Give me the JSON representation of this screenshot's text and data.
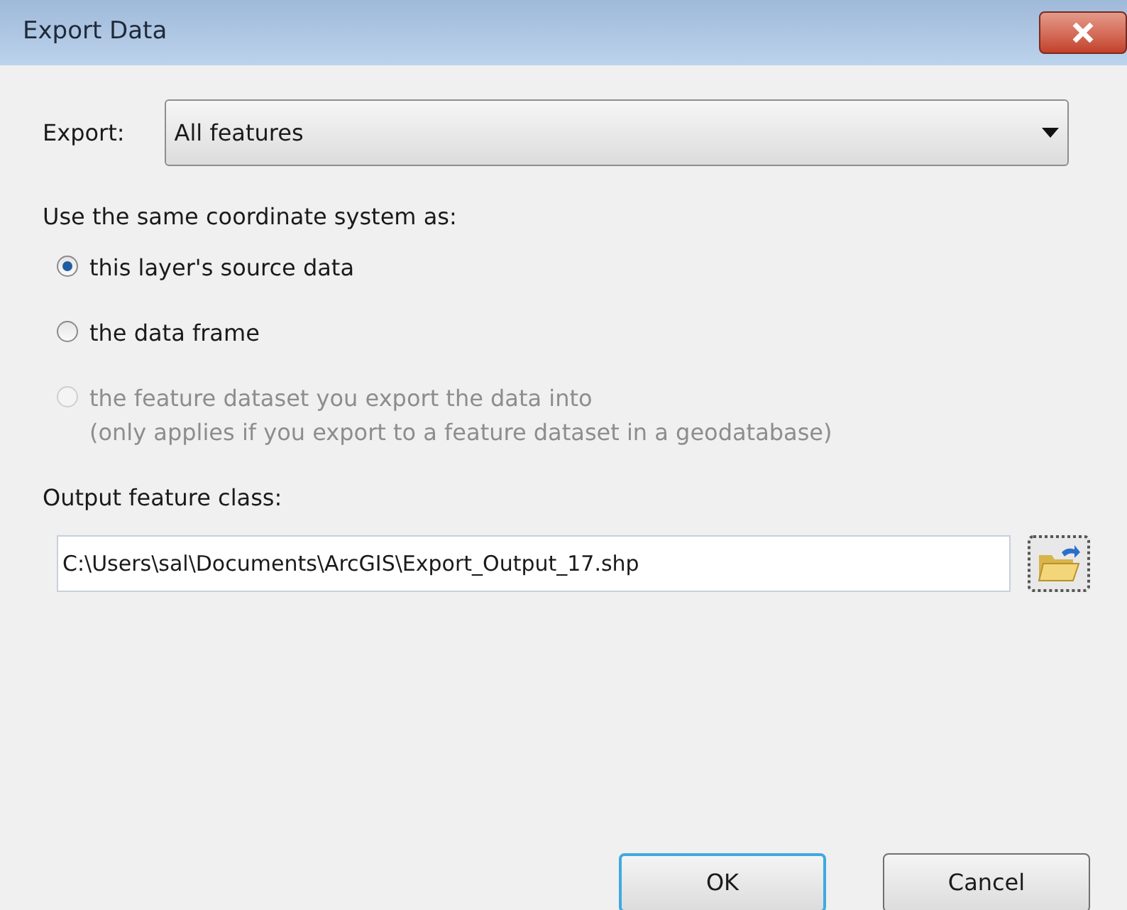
{
  "window": {
    "title": "Export Data"
  },
  "export": {
    "label": "Export:",
    "value": "All features"
  },
  "coordinate_system": {
    "label": "Use the same coordinate system as:",
    "options": [
      {
        "label": "this layer's source data",
        "selected": true,
        "disabled": false
      },
      {
        "label": "the data frame",
        "selected": false,
        "disabled": false
      },
      {
        "label": "the feature dataset you export the data into",
        "note": "(only applies if you export to a feature dataset in a geodatabase)",
        "selected": false,
        "disabled": true
      }
    ]
  },
  "output": {
    "label": "Output feature class:",
    "value": "C:\\Users\\sal\\Documents\\ArcGIS\\Export_Output_17.shp"
  },
  "buttons": [
    {
      "label": "OK",
      "default": true
    },
    {
      "label": "Cancel",
      "default": false
    }
  ]
}
